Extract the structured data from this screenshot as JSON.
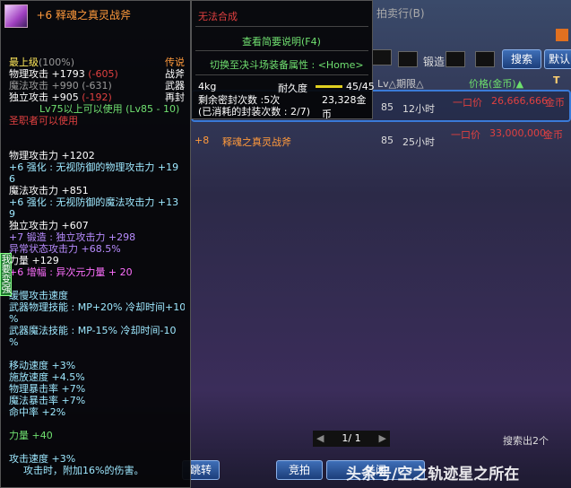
{
  "item_tooltip": {
    "title": "+6 释魂之真灵战斧",
    "grade": "最上级",
    "grade_pct": "(100%)",
    "rarity": "传说",
    "type1": "战斧",
    "type2": "武器",
    "type3": "再封",
    "phys_atk": "物理攻击 +1793",
    "phys_diff": "(-605)",
    "mag_atk": "魔法攻击 +990 (-631)",
    "ind_atk": "独立攻击 +905",
    "ind_diff": "(-192)",
    "level_req": "Lv75以上可以使用 (Lv85 - 10)",
    "class_req": "圣职者可以使用",
    "lines1": [
      "物理攻击力 +1202",
      "+6 强化 : 无视防御的物理攻击力 +19",
      "6",
      "魔法攻击力 +851",
      "+6 强化 : 无视防御的魔法攻击力 +13",
      "9",
      "独立攻击力 +607",
      "+7 锻造 : 独立攻击力 +298",
      "异常状态攻击力 +68.5%",
      "力量 +129",
      "+6 增幅 : 异次元力量 + 20"
    ],
    "lines2": [
      "缓慢攻击速度",
      "武器物理技能 : MP+20% 冷却时间+10",
      "%",
      "武器魔法技能 : MP-15% 冷却时间-10",
      "%"
    ],
    "lines3": [
      "移动速度 +3%",
      "施放速度 +4.5%",
      "物理暴击率 +7%",
      "魔法暴击率 +7%",
      "命中率 +2%"
    ],
    "str_bonus": "力量 +40",
    "atk_speed": "攻击速度 +3%",
    "on_hit": "攻击时，附加16%的伤害。"
  },
  "info_tooltip": {
    "no_synth": "无法合成",
    "brief": "查看简要说明(F4)",
    "switch": "切换至决斗场装备属性 : <Home>",
    "weight": "4kg",
    "durability_label": "耐久度",
    "durability": "45/45",
    "durability_fraction": 1.0,
    "seal_left": "剩余密封次数 :5次",
    "price": "23,328金币",
    "seal_used": "(已消耗的封装次数 : 2/7)"
  },
  "auction": {
    "title": "拍卖行(B)",
    "forge_label": "锻造",
    "search_btn": "搜索",
    "default_btn": "默认设",
    "col_lv": "Lv△期限△",
    "col_price": "价格(金币)▲",
    "rows": [
      {
        "lv": "85",
        "time": "12小时",
        "type": "一口价",
        "price": "26,666,666",
        "unit": "金币"
      },
      {
        "enh": "+8",
        "name": "释魂之真灵战斧",
        "lv": "85",
        "time": "25小时",
        "type": "一口价",
        "price": "33,000,000",
        "unit": "金币"
      }
    ],
    "page": "1/ 1",
    "result": "搜索出2个",
    "jump_btn": "跳转",
    "bid_btn": "竞拍",
    "close_btn": "关闭"
  },
  "watermark": "头条号/空之轨迹星之所在",
  "side_tab": "我要变强"
}
